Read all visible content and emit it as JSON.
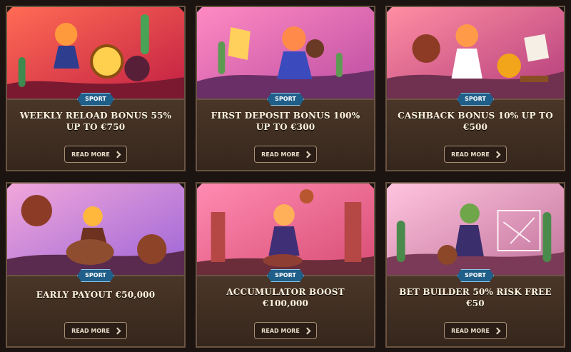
{
  "cards": [
    {
      "title": "WEEKLY RELOAD BONUS 55% UP TO €750",
      "badge": "SPORT",
      "cta": "READ MORE",
      "theme": [
        "#ff6b54",
        "#c21f43",
        "#ffd04d"
      ]
    },
    {
      "title": "FIRST DEPOSIT BONUS 100% UP TO €300",
      "badge": "SPORT",
      "cta": "READ MORE",
      "theme": [
        "#ff8ac2",
        "#bb4da2",
        "#ffca6a"
      ]
    },
    {
      "title": "CASHBACK BONUS 10% UP TO €500",
      "badge": "SPORT",
      "cta": "READ MORE",
      "theme": [
        "#ff8ea2",
        "#b33c7c",
        "#ffc163"
      ]
    },
    {
      "title": "EARLY PAYOUT €50,000",
      "badge": "SPORT",
      "cta": "READ MORE",
      "theme": [
        "#f1a7da",
        "#9c64d8",
        "#ffd27a"
      ]
    },
    {
      "title": "ACCUMULATOR BOOST €100,000",
      "badge": "SPORT",
      "cta": "READ MORE",
      "theme": [
        "#ff8bb2",
        "#d74c73",
        "#ff9a63"
      ]
    },
    {
      "title": "BET BUILDER 50% RISK FREE €50",
      "badge": "SPORT",
      "cta": "READ MORE",
      "theme": [
        "#ffc4df",
        "#c1729a",
        "#ffe3f0"
      ]
    }
  ]
}
